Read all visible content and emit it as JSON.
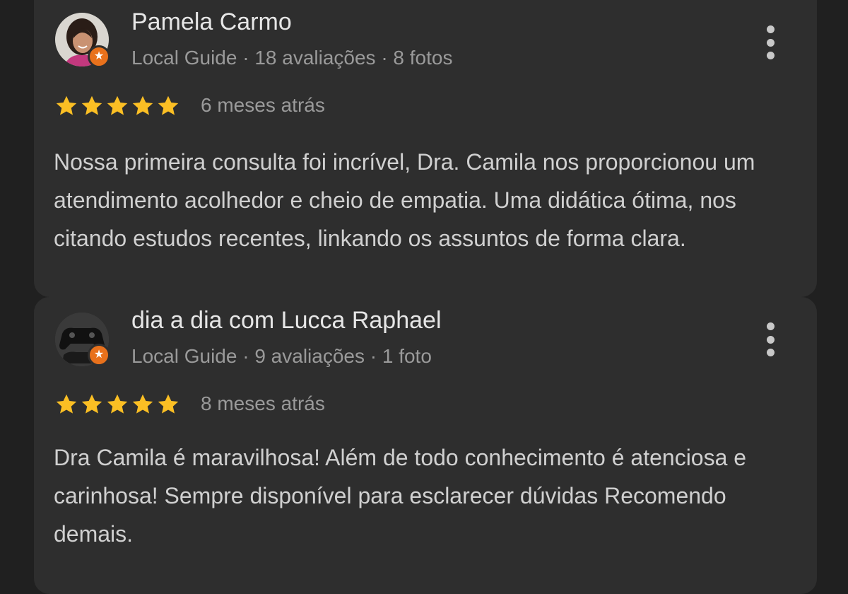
{
  "colors": {
    "background": "#202020",
    "card": "#2e2e2e",
    "star": "#fbbf24",
    "badge": "#e8711c"
  },
  "reviews": [
    {
      "name": "Pamela Carmo",
      "meta": "Local Guide · 18 avaliações · 8 fotos",
      "rating": 5,
      "time": "6 meses atrás",
      "text": "Nossa primeira consulta foi incrível, Dra. Camila nos proporcionou um atendimento acolhedor e cheio de empatia. Uma didática ótima, nos citando estudos recentes, linkando os assuntos de forma clara.",
      "avatar_icon": "person-photo-icon",
      "badge_icon": "local-guide-star-icon",
      "menu_icon": "more-vert-icon"
    },
    {
      "name": "dia a dia com Lucca Raphael",
      "meta": "Local Guide · 9 avaliações · 1 foto",
      "rating": 5,
      "time": "8 meses atrás",
      "text": "Dra Camila é maravilhosa! Além de todo conhecimento é atenciosa e carinhosa! Sempre disponível para esclarecer dúvidas Recomendo demais.",
      "avatar_icon": "game-controller-icon",
      "badge_icon": "local-guide-star-icon",
      "menu_icon": "more-vert-icon"
    }
  ]
}
